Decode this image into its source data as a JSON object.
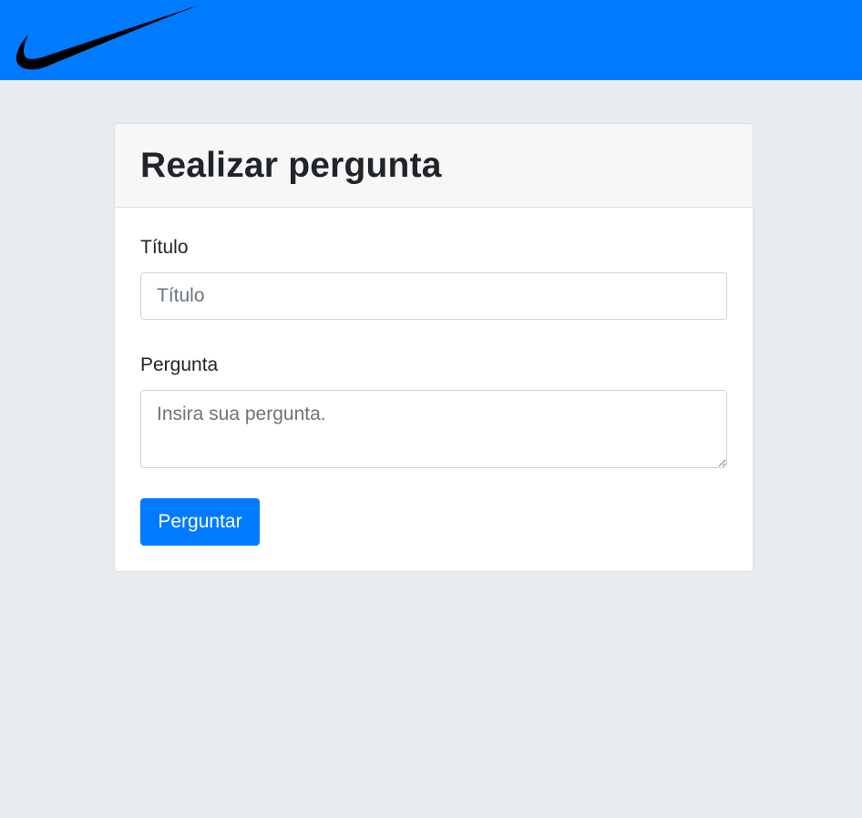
{
  "navbar": {
    "logo_icon": "swoosh-logo-icon",
    "background_color": "#007bff"
  },
  "card": {
    "title": "Realizar pergunta",
    "form": {
      "titulo_label": "Título",
      "titulo_placeholder": "Título",
      "titulo_value": "",
      "pergunta_label": "Pergunta",
      "pergunta_placeholder": "Insira sua pergunta.",
      "pergunta_value": "",
      "submit_label": "Perguntar"
    }
  },
  "colors": {
    "accent": "#007bff",
    "page_background": "#e9ecef",
    "card_header_background": "#f7f7f7"
  }
}
